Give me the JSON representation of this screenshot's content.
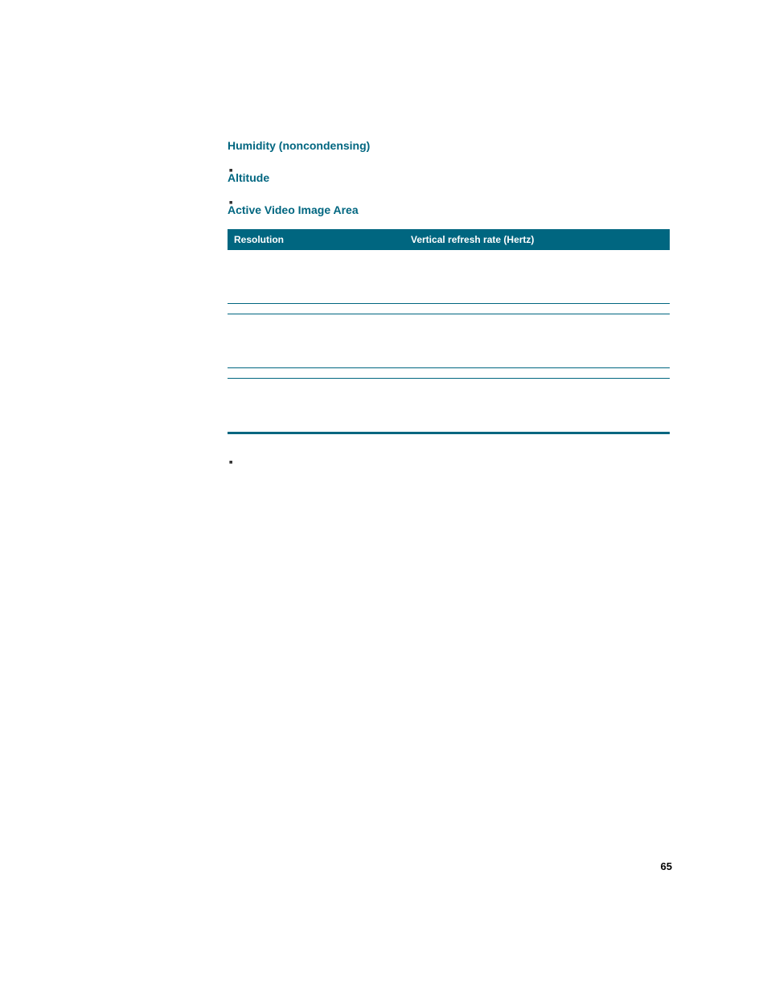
{
  "sections": {
    "humidity": {
      "heading": "Humidity (noncondensing)",
      "items": [
        "",
        "",
        ""
      ]
    },
    "altitude": {
      "heading": "Altitude",
      "items": [
        "",
        ""
      ]
    },
    "video": {
      "heading": "Active Video Image Area",
      "intro": ""
    }
  },
  "table": {
    "headers": {
      "resolution": "Resolution",
      "refresh": "Vertical refresh rate (Hertz)"
    }
  },
  "chart_data": {
    "type": "table",
    "title": "Active Video Image Area",
    "columns": [
      "Resolution",
      "Vertical refresh rate (Hertz)"
    ],
    "rows": [
      {
        "resolution": "",
        "refresh": "",
        "multi": true
      },
      {
        "resolution": "",
        "refresh": ""
      },
      {
        "resolution": "",
        "refresh": "",
        "multi": true
      },
      {
        "resolution": "",
        "refresh": ""
      },
      {
        "resolution": "",
        "refresh": "",
        "multi": true
      }
    ]
  },
  "postTable": {
    "para": "",
    "items": [
      "",
      "",
      ""
    ]
  },
  "pageNumber": "65"
}
